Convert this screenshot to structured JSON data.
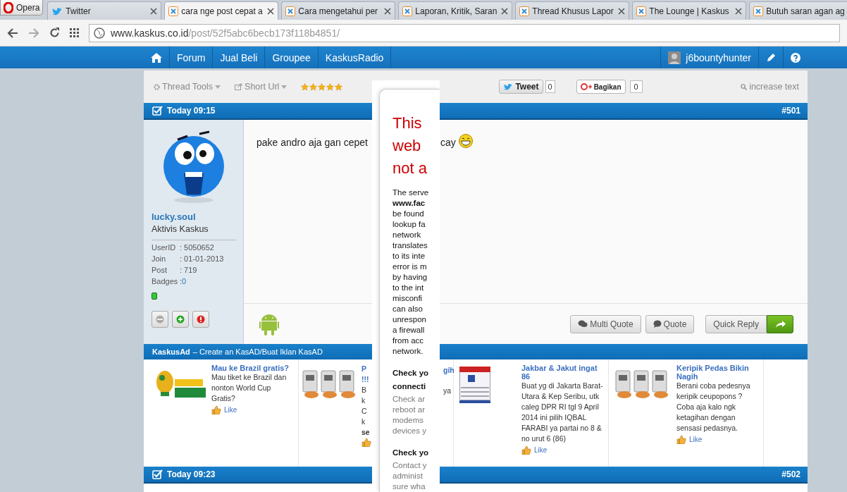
{
  "browser": {
    "opera_button": "Opera",
    "tabs": [
      {
        "title": "Twitter",
        "kind": "twitter",
        "selected": false
      },
      {
        "title": "cara nge post cepat a",
        "kind": "site",
        "selected": true
      },
      {
        "title": "Cara mengetahui per",
        "kind": "site",
        "selected": false
      },
      {
        "title": "Laporan, Kritik, Saran",
        "kind": "site",
        "selected": false
      },
      {
        "title": "Thread Khusus Lapor",
        "kind": "site",
        "selected": false
      },
      {
        "title": "The Lounge | Kaskus",
        "kind": "site",
        "selected": false
      },
      {
        "title": "Butuh saran agan ag",
        "kind": "site",
        "selected": false
      }
    ],
    "address": {
      "domain": "www.kaskus.co.id",
      "path": "/post/52f5abc6becb173f118b4851/"
    }
  },
  "nav": {
    "items": [
      "Forum",
      "Jual Beli",
      "Groupee",
      "KaskusRadio"
    ],
    "username": "j6bountyhunter"
  },
  "toolbar": {
    "thread_tools": "Thread Tools",
    "short_url": "Short Url",
    "stars": 5,
    "tweet": "Tweet",
    "tweet_count": "0",
    "share": "Bagikan",
    "share_count": "0",
    "increase_text": "increase text"
  },
  "post": {
    "time": "Today 09:15",
    "number": "#501",
    "user": {
      "name": "lucky.soul",
      "rank": "Aktivis Kaskus",
      "online": true,
      "stats": [
        {
          "label": "UserID",
          "value": ": 5050652"
        },
        {
          "label": "Join",
          "value": ": 01-01-2013"
        },
        {
          "label": "Post",
          "value": ": 719"
        },
        {
          "label": "Badges",
          "value": ": ",
          "link": "0"
        }
      ]
    },
    "text_before": "pake andro aja gan cepet",
    "text_after": "cay",
    "buttons": {
      "multi_quote": "Multi Quote",
      "quote": "Quote",
      "quick_reply": "Quick Reply"
    }
  },
  "ad_bar": {
    "brand": "KaskusAd",
    "text": "– Create an KasAD/Buat Iklan KasAD"
  },
  "ads": [
    {
      "kind": "full",
      "title": "Mau ke Brazil gratis?",
      "body": "Mau tiket ke Brazil dan nonton World Cup Gratis?",
      "like": "Like"
    },
    {
      "kind": "fragments",
      "left": [
        {
          "text": "P",
          "kind": "title"
        },
        {
          "text": "!!!",
          "kind": "title"
        },
        {
          "text": "B",
          "kind": "body"
        },
        {
          "text": "k",
          "kind": "body"
        },
        {
          "text": "C",
          "kind": "body"
        },
        {
          "text": "k",
          "kind": "body"
        },
        {
          "text": "se",
          "kind": "strong"
        }
      ],
      "right": [
        {
          "text": "gih",
          "kind": "title"
        },
        {
          "text": "ya",
          "kind": "body"
        }
      ]
    },
    {
      "kind": "full",
      "title": "Jakbar & Jakut ingat 86",
      "body": "Buat yg di Jakarta Barat-Utara & Kep Seribu, utk caleg DPR RI tgl 9 April 2014 ini pilih IQBAL FARABI ya partai no 8 & no urut 6 (86)",
      "like": "Like"
    },
    {
      "kind": "full",
      "title": "Keripik Pedas Bikin Nagih",
      "body": "Berani coba pedesnya keripik ceupopons ? Coba aja kalo ngk ketagihan dengan sensasi pedasnya.",
      "like": "Like"
    }
  ],
  "next_post": {
    "time": "Today 09:23",
    "number": "#502"
  },
  "error_page": {
    "heading": [
      "This",
      "web",
      "not a"
    ],
    "lines": [
      {
        "text": "The serve",
        "kind": "normal"
      },
      {
        "text": "www.fac",
        "kind": "bold"
      },
      {
        "text": "be found",
        "kind": "normal"
      },
      {
        "text": "lookup fa",
        "kind": "normal"
      },
      {
        "text": "network",
        "kind": "normal"
      },
      {
        "text": "translates",
        "kind": "normal"
      },
      {
        "text": "to its inte",
        "kind": "normal"
      },
      {
        "text": "error is m",
        "kind": "normal"
      },
      {
        "text": "by having",
        "kind": "normal"
      },
      {
        "text": "to the int",
        "kind": "normal"
      },
      {
        "text": "misconfi",
        "kind": "normal"
      },
      {
        "text": "can also",
        "kind": "normal"
      },
      {
        "text": "unrespon",
        "kind": "normal"
      },
      {
        "text": "a firewall",
        "kind": "normal"
      },
      {
        "text": "from acc",
        "kind": "normal"
      },
      {
        "text": "network.",
        "kind": "normal"
      },
      {
        "text": "Check yo",
        "kind": "heading"
      },
      {
        "text": "connecti",
        "kind": "heading"
      },
      {
        "text": "Check ar",
        "kind": "muted"
      },
      {
        "text": "reboot ar",
        "kind": "muted"
      },
      {
        "text": "modems",
        "kind": "muted"
      },
      {
        "text": "devices y",
        "kind": "muted"
      },
      {
        "text": "Check yo",
        "kind": "heading"
      },
      {
        "text": "Contact y",
        "kind": "muted"
      },
      {
        "text": "administ",
        "kind": "muted"
      },
      {
        "text": "sure wha",
        "kind": "muted"
      }
    ]
  }
}
